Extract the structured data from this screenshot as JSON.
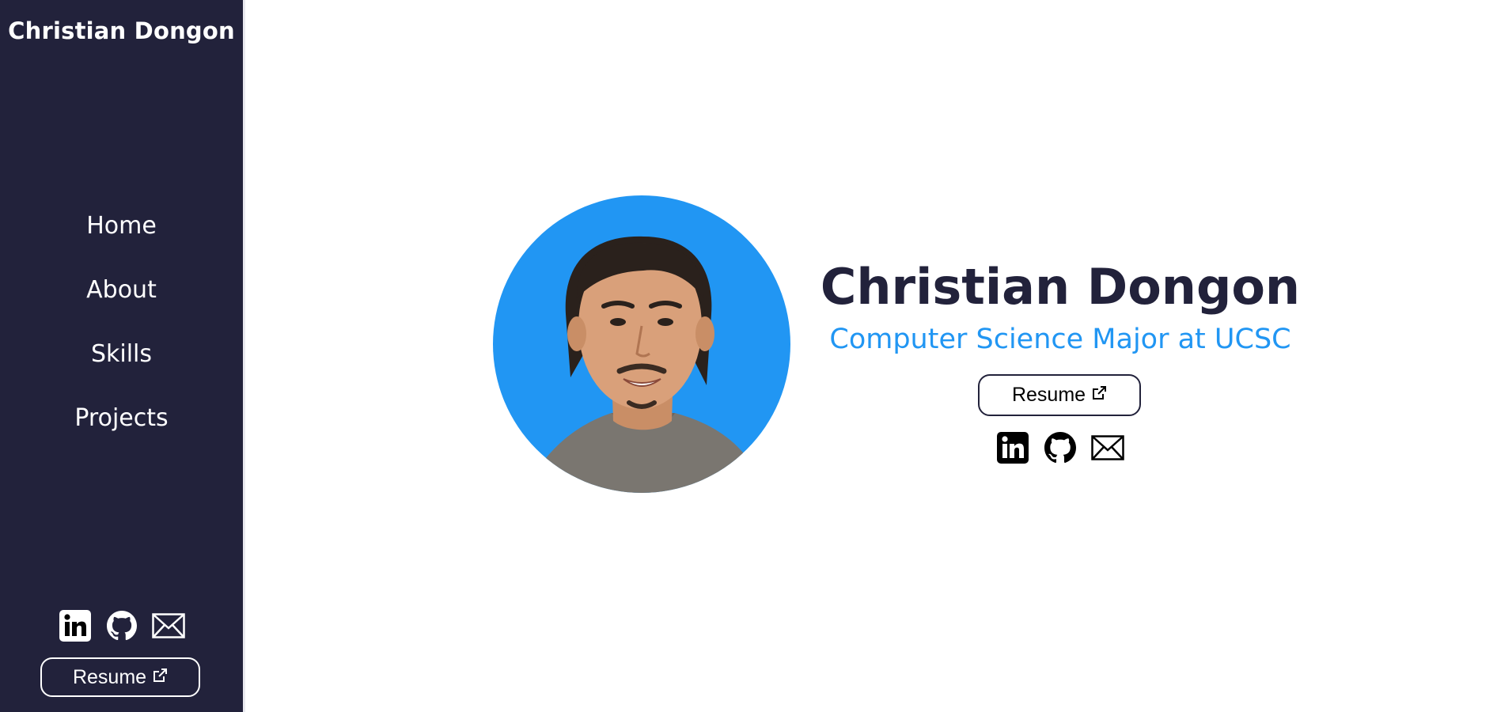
{
  "sidebar": {
    "brand": "Christian Dongon",
    "nav": [
      {
        "label": "Home"
      },
      {
        "label": "About"
      },
      {
        "label": "Skills"
      },
      {
        "label": "Projects"
      }
    ],
    "social_icons": [
      "linkedin-icon",
      "github-icon",
      "mail-icon"
    ],
    "resume_label": "Resume"
  },
  "hero": {
    "name": "Christian Dongon",
    "subtitle": "Computer Science Major at UCSC",
    "resume_label": "Resume",
    "social_icons": [
      "linkedin-icon",
      "github-icon",
      "mail-icon"
    ]
  },
  "colors": {
    "sidebar_bg": "#22223b",
    "accent": "#2196f3",
    "name_text": "#22223b",
    "page_bg": "#ffffff"
  }
}
